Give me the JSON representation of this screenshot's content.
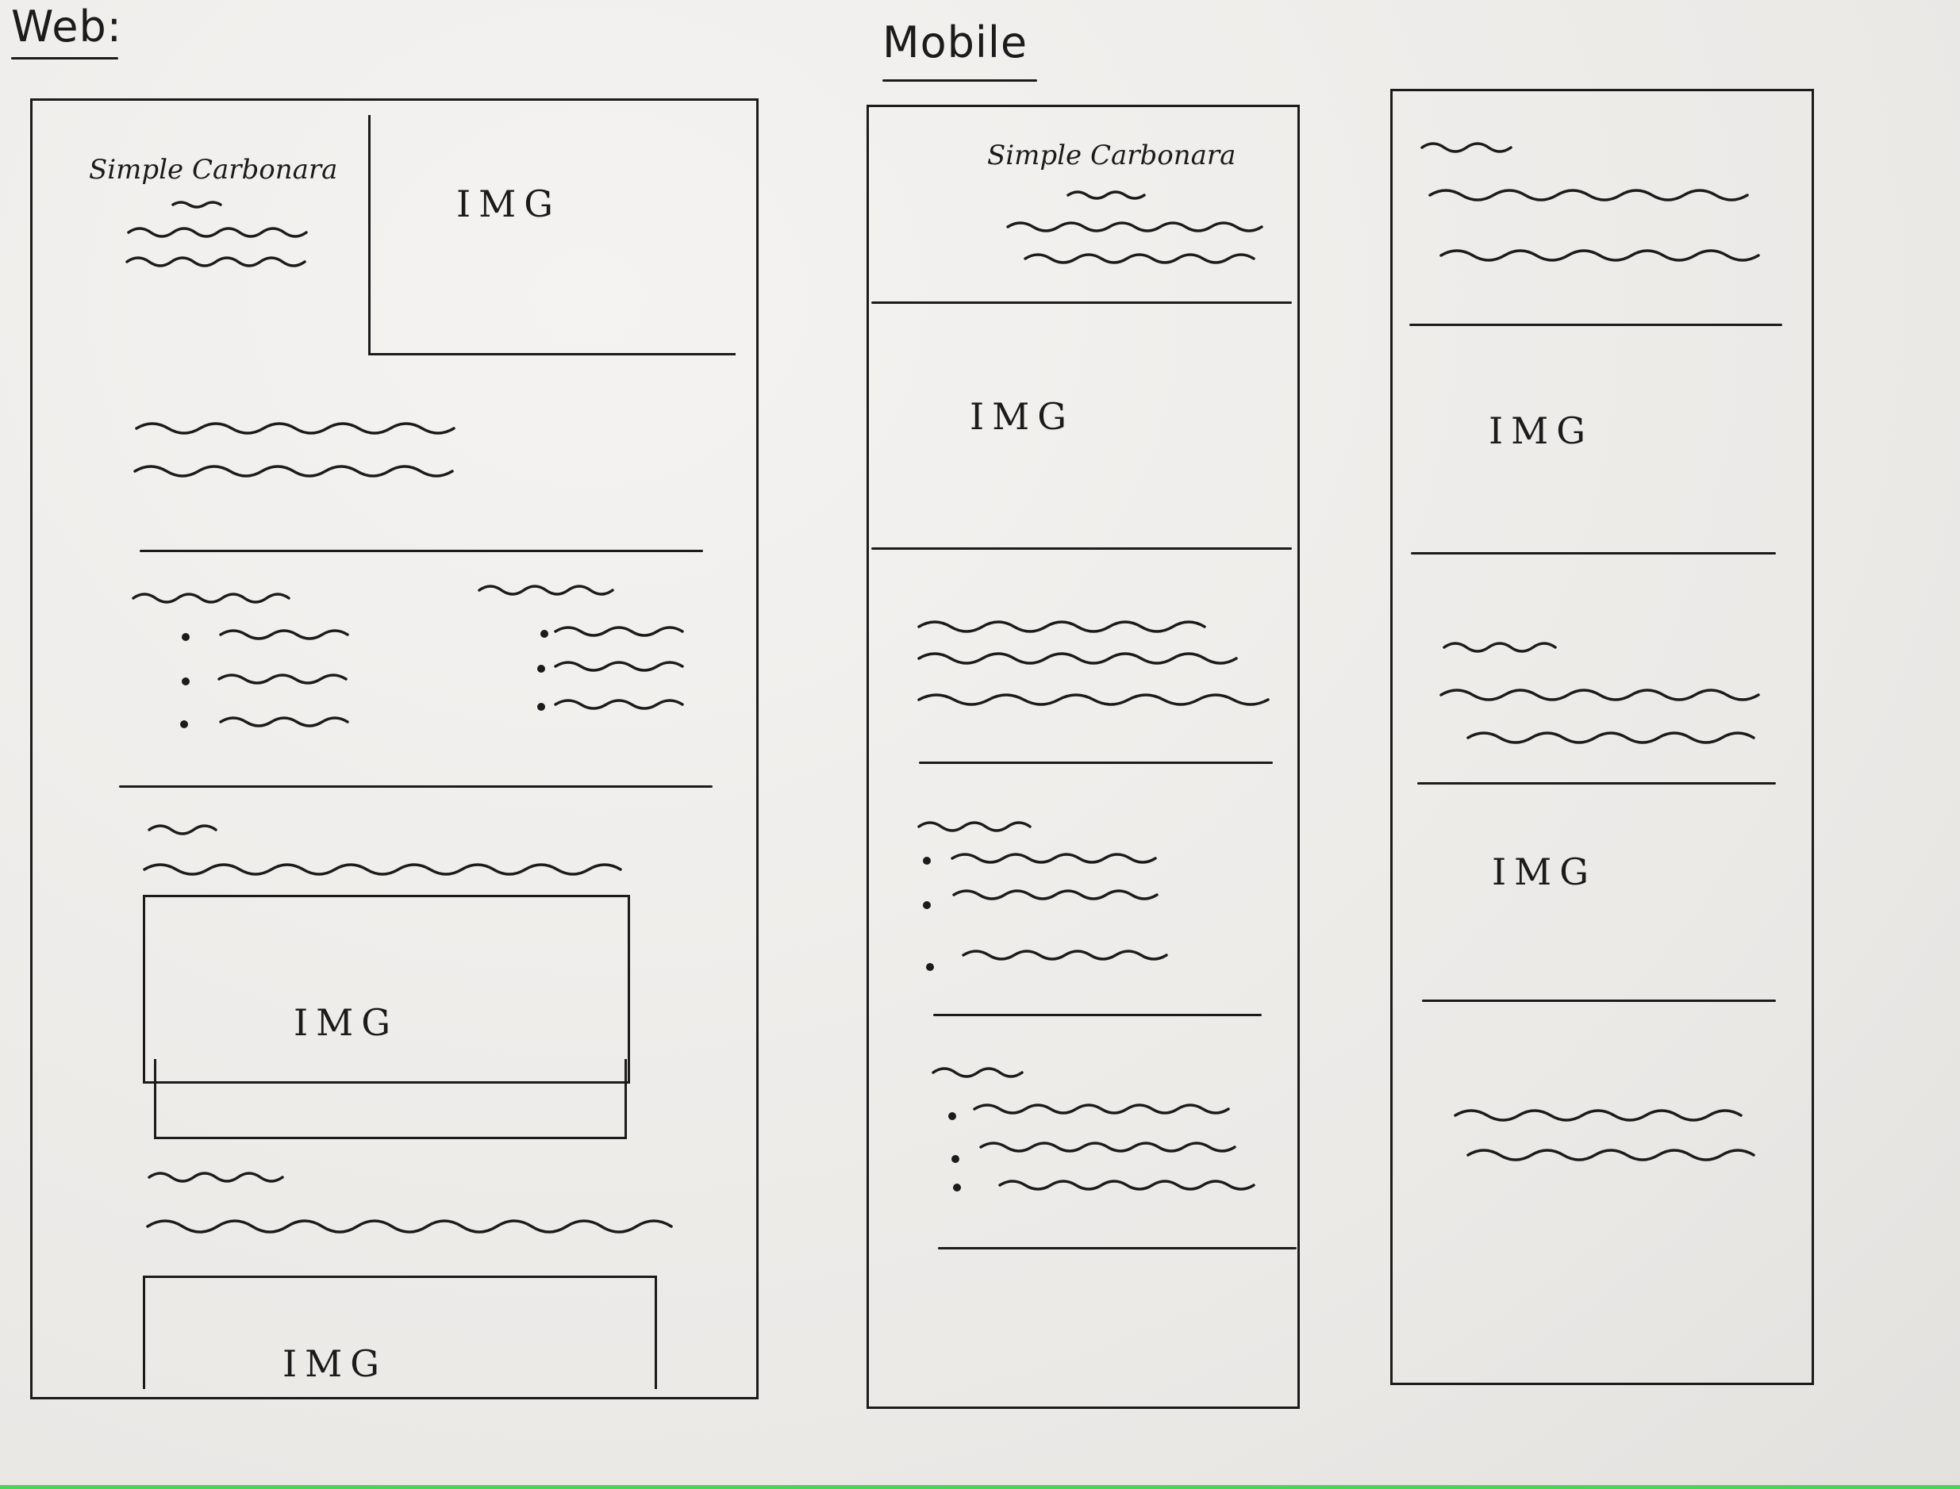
{
  "labels": {
    "web_heading": "Web:",
    "mobile_heading": "Mobile",
    "recipe_title": "Simple Carbonara",
    "image_placeholder": "IMG"
  },
  "colors": {
    "ink": "#1b1b1b",
    "paper": "#efedeb",
    "bottom_strip": "#4bd45a"
  }
}
